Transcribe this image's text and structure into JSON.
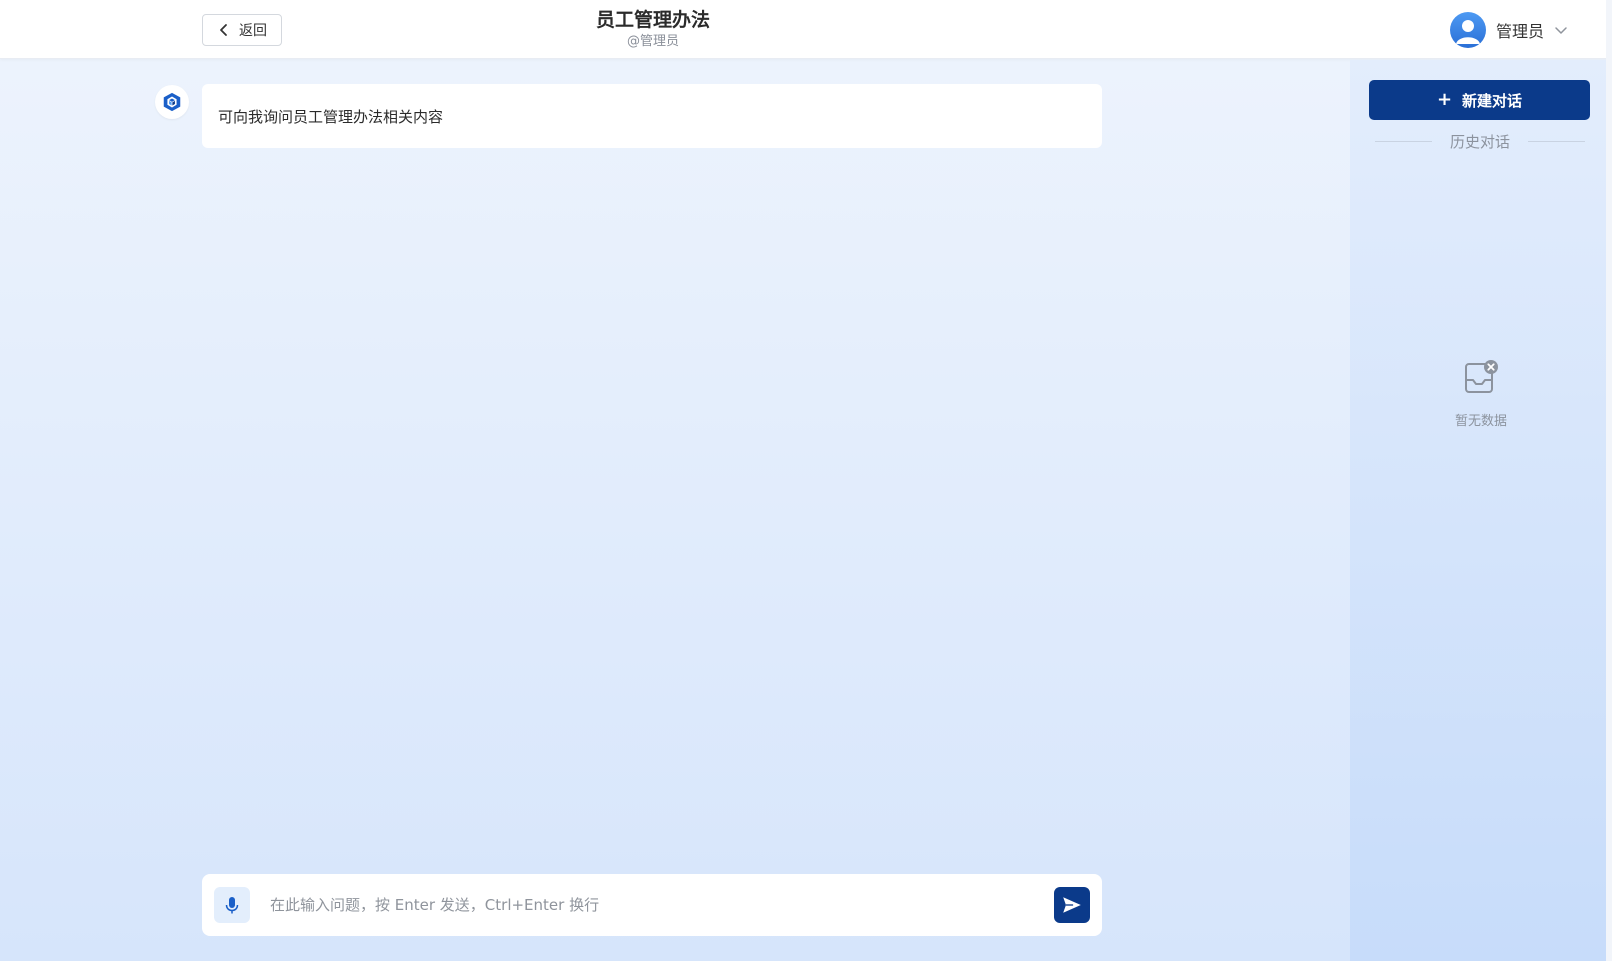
{
  "header": {
    "back_label": "返回",
    "title": "员工管理办法",
    "subtitle": "@管理员",
    "user_name": "管理员"
  },
  "chat": {
    "messages": [
      {
        "role": "bot",
        "text": "可向我询问员工管理办法相关内容"
      }
    ]
  },
  "input": {
    "placeholder": "在此输入问题，按 Enter 发送，Ctrl+Enter 换行",
    "value": ""
  },
  "sidebar": {
    "new_chat_label": "新建对话",
    "history_label": "历史对话",
    "empty_text": "暂无数据"
  },
  "icons": {
    "back": "chevron-left-icon",
    "avatar": "user-avatar-icon",
    "dropdown": "chevron-down-icon",
    "bot": "cube-logo-icon",
    "mic": "microphone-icon",
    "send": "send-icon",
    "plus": "plus-icon",
    "empty": "empty-inbox-icon"
  },
  "colors": {
    "primary": "#0b3a8a",
    "mic_bg": "#e3eefc",
    "avatar_blue": "#2a6fd6"
  }
}
